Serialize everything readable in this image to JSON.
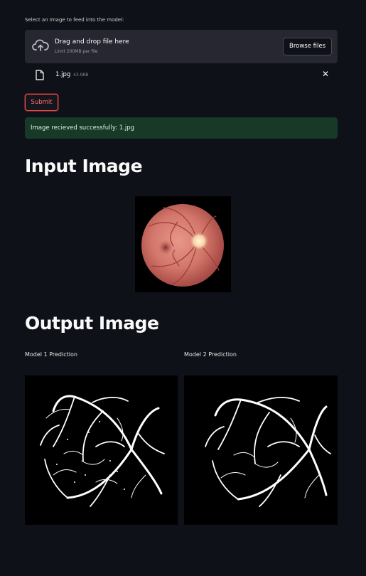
{
  "uploader": {
    "label": "Select an Image to feed into the model:",
    "drop_title": "Drag and drop file here",
    "limit": "Limit 200MB per file",
    "browse_label": "Browse files"
  },
  "file": {
    "name": "1.jpg",
    "size": "43.9KB",
    "close": "✕"
  },
  "submit_label": "Submit",
  "success_message": "Image recieved successfully: 1.jpg",
  "input_heading": "Input Image",
  "output_heading": "Output Image",
  "predictions": [
    {
      "caption": "Model 1 Prediction"
    },
    {
      "caption": "Model 2 Prediction"
    }
  ],
  "colors": {
    "background": "#0e1117",
    "accent": "#ff4b4b",
    "success_bg": "#173928"
  }
}
